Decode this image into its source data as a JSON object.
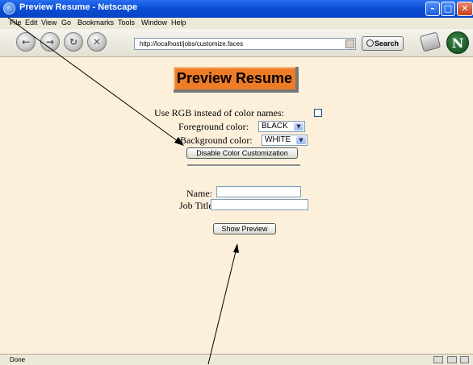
{
  "window": {
    "title": "Preview Resume - Netscape",
    "controls": {
      "minimize": "–",
      "maximize": "□",
      "close": "✕"
    }
  },
  "menu": [
    "File",
    "Edit",
    "View",
    "Go",
    "Bookmarks",
    "Tools",
    "Window",
    "Help"
  ],
  "toolbar": {
    "back_glyph": "←",
    "forward_glyph": "→",
    "reload_glyph": "↻",
    "stop_glyph": "✕",
    "url": "http://localhost/jobs/customize.faces",
    "search_label": "Search",
    "logo_letter": "N"
  },
  "page": {
    "heading": "Preview Resume",
    "rgb_label": "Use RGB instead of color names:",
    "fg_label": "Foreground color:",
    "fg_value": "BLACK",
    "bg_label": "Background color:",
    "bg_value": "WHITE",
    "disable_button": "Disable Color Customization",
    "name_label": "Name:",
    "name_value": "",
    "job_label": "Job Title:",
    "job_value": "",
    "preview_button": "Show Preview",
    "dropdown_glyph": "▼"
  },
  "status": {
    "text": "Done"
  },
  "colors": {
    "heading_bg": "#ee7c26",
    "page_bg": "#fdf0db",
    "title_bar": "#0a4fd6"
  }
}
